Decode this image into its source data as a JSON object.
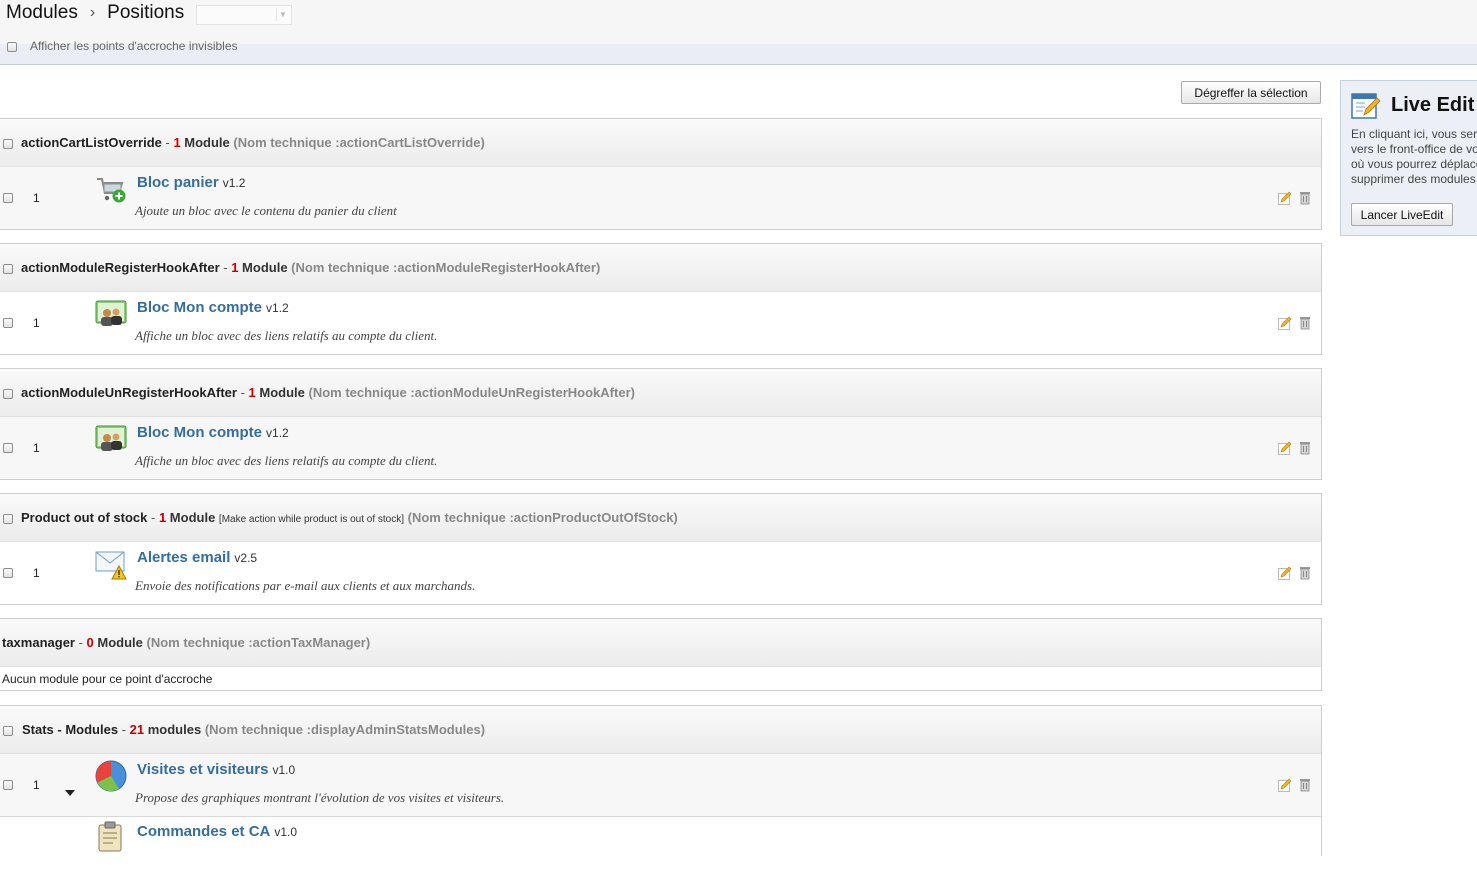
{
  "breadcrumb": {
    "first": "Modules",
    "separator": "›",
    "second": "Positions"
  },
  "options": {
    "show_invisible_label": "Afficher les points d'accroche invisibles"
  },
  "toolbar": {
    "unhook_label": "Dégreffer la sélection"
  },
  "liveedit": {
    "title": "Live Edit",
    "text": "En cliquant ici, vous serez redirigé vers le front-office de votre boutique où vous pourrez déplacer et supprimer des modules directement.",
    "button": "Lancer LiveEdit"
  },
  "hooks": [
    {
      "name": "actionCartListOverride",
      "sep": " - ",
      "count": "1",
      "module_label": " Module",
      "extra": "",
      "tech": "(Nom technique :actionCartListOverride)",
      "modules": [
        {
          "position": "1",
          "name": "Bloc panier",
          "version": "v1.2",
          "desc": "Ajoute un bloc avec le contenu du panier du client",
          "icon": "cart-icon"
        }
      ]
    },
    {
      "name": "actionModuleRegisterHookAfter",
      "sep": " - ",
      "count": "1",
      "module_label": " Module",
      "extra": "",
      "tech": "(Nom technique :actionModuleRegisterHookAfter)",
      "modules": [
        {
          "position": "1",
          "name": "Bloc Mon compte",
          "version": "v1.2",
          "desc": "Affiche un bloc avec des liens relatifs au compte du client.",
          "icon": "account-icon"
        }
      ]
    },
    {
      "name": "actionModuleUnRegisterHookAfter",
      "sep": " - ",
      "count": "1",
      "module_label": " Module",
      "extra": "",
      "tech": "(Nom technique :actionModuleUnRegisterHookAfter)",
      "modules": [
        {
          "position": "1",
          "name": "Bloc Mon compte",
          "version": "v1.2",
          "desc": "Affiche un bloc avec des liens relatifs au compte du client.",
          "icon": "account-icon"
        }
      ]
    },
    {
      "name": "Product out of stock",
      "sep": " - ",
      "count": "1",
      "module_label": " Module",
      "extra": "[Make action while product is out of stock]",
      "tech": "(Nom technique :actionProductOutOfStock)",
      "modules": [
        {
          "position": "1",
          "name": "Alertes email",
          "version": "v2.5",
          "desc": "Envoie des notifications par e-mail aux clients et aux marchands.",
          "icon": "mail-alert-icon"
        }
      ]
    },
    {
      "name": "taxmanager",
      "sep": " - ",
      "count": "0",
      "module_label": " Module",
      "extra": "",
      "tech": "(Nom technique :actionTaxManager)",
      "empty": "Aucun module pour ce point d'accroche",
      "modules": []
    },
    {
      "name": "Stats - Modules",
      "sep": " - ",
      "count": "21",
      "module_label": " modules",
      "extra": "",
      "tech": "(Nom technique :displayAdminStatsModules)",
      "modules": [
        {
          "position": "1",
          "name": "Visites et visiteurs",
          "version": "v1.0",
          "desc": "Propose des graphiques montrant l'évolution de vos visites et visiteurs.",
          "icon": "pie-chart-icon"
        },
        {
          "position": "",
          "name": "Commandes et CA",
          "version": "v1.0",
          "desc": "",
          "icon": "clipboard-icon"
        }
      ]
    }
  ]
}
